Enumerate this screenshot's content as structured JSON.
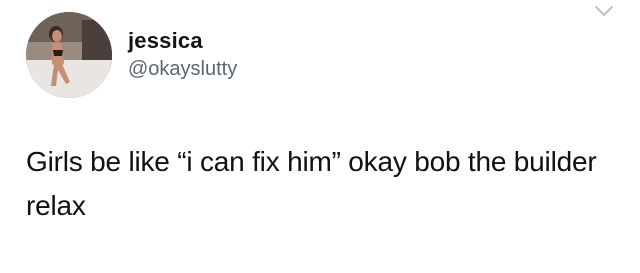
{
  "tweet": {
    "author": {
      "display_name": "jessica",
      "handle": "@okayslutty",
      "avatar_icon": "user-avatar-photo"
    },
    "text": "Girls be like “i can fix him” okay bob the builder relax",
    "menu_icon": "chevron-down-icon",
    "colors": {
      "background": "#ffffff",
      "name": "#141414",
      "handle": "#5b6670",
      "text": "#111111",
      "chevron": "#b8c0c7"
    }
  }
}
